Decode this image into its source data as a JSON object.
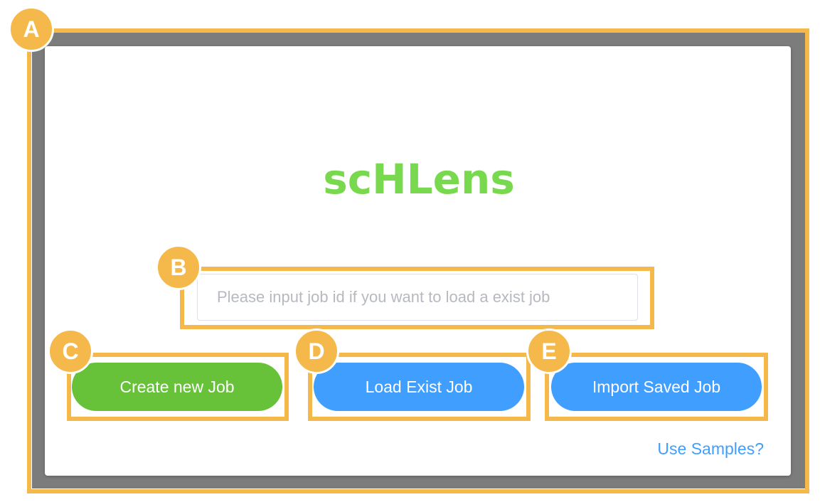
{
  "logo": {
    "text": "scHLens",
    "color": "#78d84e"
  },
  "job_id_input": {
    "value": "",
    "placeholder": "Please input job id if you want to load a exist job"
  },
  "buttons": {
    "create": {
      "label": "Create new Job",
      "color": "#67c23a"
    },
    "load": {
      "label": "Load Exist Job",
      "color": "#409eff"
    },
    "import": {
      "label": "Import Saved Job",
      "color": "#409eff"
    }
  },
  "samples_link": {
    "label": "Use Samples?"
  },
  "annotations": {
    "color": "#f4b94a",
    "badges": [
      "A",
      "B",
      "C",
      "D",
      "E"
    ]
  }
}
